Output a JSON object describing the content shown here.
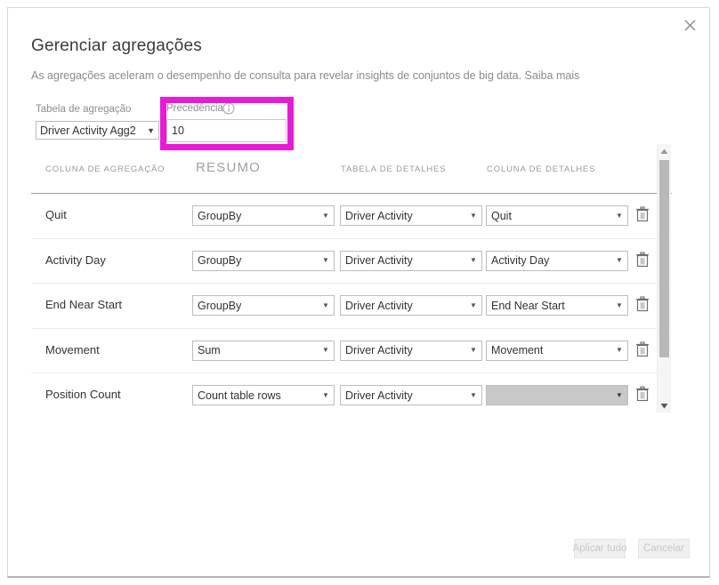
{
  "dialog": {
    "title": "Gerenciar agregações",
    "description": "As agregações aceleram o desempenho de consulta para revelar insights de conjuntos de big data.",
    "learn_more": "Saiba mais",
    "close_label": "Fechar"
  },
  "fields": {
    "agg_table_label": "Tabela de agregação",
    "agg_table_value": "Driver Activity Agg2",
    "precedence_label": "Precedência",
    "precedence_value": "10",
    "precedence_placeholder": ""
  },
  "table": {
    "headers": {
      "aggregation_column": "COLUNA DE AGREGAÇÃO",
      "summary": "RESUMO",
      "detail_table": "TABELA DE DETALHES",
      "detail_column": "COLUNA DE DETALHES"
    },
    "rows": [
      {
        "aggregation_column": "Quit",
        "summary": "GroupBy",
        "detail_table": "Driver Activity",
        "detail_column": "Quit",
        "detail_column_disabled": false
      },
      {
        "aggregation_column": "Activity Day",
        "summary": "GroupBy",
        "detail_table": "Driver Activity",
        "detail_column": "Activity Day",
        "detail_column_disabled": false
      },
      {
        "aggregation_column": "End Near Start",
        "summary": "GroupBy",
        "detail_table": "Driver Activity",
        "detail_column": "End Near Start",
        "detail_column_disabled": false
      },
      {
        "aggregation_column": "Movement",
        "summary": "Sum",
        "detail_table": "Driver Activity",
        "detail_column": "Movement",
        "detail_column_disabled": false
      },
      {
        "aggregation_column": "Position Count",
        "summary": "Count table rows",
        "detail_table": "Driver Activity",
        "detail_column": "",
        "detail_column_disabled": true
      }
    ]
  },
  "footer": {
    "apply_all": "Aplicar tudo",
    "cancel": "Cancelar"
  },
  "annotation": {
    "highlight_color": "#e81ad6"
  },
  "icons": {
    "close": "close-icon",
    "info": "info-icon",
    "delete": "trash-icon",
    "dropdown": "chevron-down-icon"
  }
}
